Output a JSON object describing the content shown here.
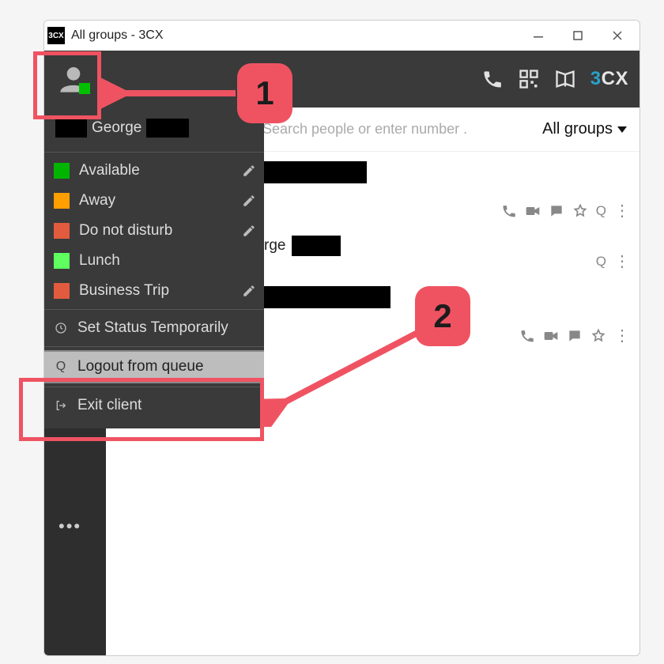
{
  "window": {
    "title": "All groups - 3CX",
    "app_icon_text": "3CX"
  },
  "header": {
    "brand_a": "3",
    "brand_b": "CX"
  },
  "search": {
    "placeholder": "Search people or enter number ."
  },
  "filter": {
    "label": "All groups"
  },
  "dropdown": {
    "user_name": "George",
    "statuses": [
      {
        "label": "Available",
        "color": "#00b400",
        "editable": true
      },
      {
        "label": "Away",
        "color": "#ff9f00",
        "editable": true
      },
      {
        "label": "Do not disturb",
        "color": "#e25b3e",
        "editable": true
      },
      {
        "label": "Lunch",
        "color": "#5eff5e",
        "editable": false
      },
      {
        "label": "Business Trip",
        "color": "#e25b3e",
        "editable": true
      }
    ],
    "set_temp": "Set Status Temporarily",
    "logout_queue": "Logout from queue",
    "exit": "Exit client"
  },
  "contacts": [
    {
      "name_suffix": "",
      "layout": "double",
      "actions": [
        "phone",
        "video",
        "chat",
        "star",
        "queue",
        "menu"
      ]
    },
    {
      "name_prefix": "rge",
      "layout": "single",
      "actions": [
        "queue",
        "menu"
      ]
    },
    {
      "name_suffix": "",
      "layout": "double",
      "actions": [
        "phone",
        "video",
        "chat",
        "star",
        "menu"
      ]
    }
  ],
  "annotations": {
    "badge1": "1",
    "badge2": "2"
  }
}
